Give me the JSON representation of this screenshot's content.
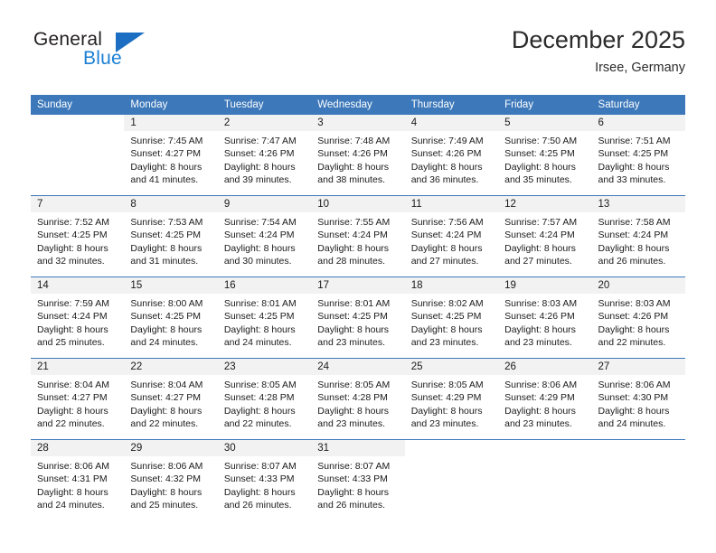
{
  "brand": {
    "name_primary": "General",
    "name_secondary": "Blue",
    "triangle_color": "#1b6ec2",
    "blue_color": "#1b7fd4"
  },
  "header": {
    "title": "December 2025",
    "location": "Irsee, Germany"
  },
  "theme": {
    "header_bg": "#3c78ba",
    "header_text": "#ffffff",
    "daynum_band_bg": "#f2f2f2",
    "row_divider": "#3c78ba",
    "text": "#1a1a1a"
  },
  "weekday_headers": [
    "Sunday",
    "Monday",
    "Tuesday",
    "Wednesday",
    "Thursday",
    "Friday",
    "Saturday"
  ],
  "labels": {
    "sunrise_prefix": "Sunrise:",
    "sunset_prefix": "Sunset:",
    "daylight_prefix": "Daylight:"
  },
  "weeks": [
    [
      {
        "day": "",
        "sunrise": "",
        "sunset": "",
        "daylight_line1": "",
        "daylight_line2": ""
      },
      {
        "day": "1",
        "sunrise": "Sunrise: 7:45 AM",
        "sunset": "Sunset: 4:27 PM",
        "daylight_line1": "Daylight: 8 hours",
        "daylight_line2": "and 41 minutes."
      },
      {
        "day": "2",
        "sunrise": "Sunrise: 7:47 AM",
        "sunset": "Sunset: 4:26 PM",
        "daylight_line1": "Daylight: 8 hours",
        "daylight_line2": "and 39 minutes."
      },
      {
        "day": "3",
        "sunrise": "Sunrise: 7:48 AM",
        "sunset": "Sunset: 4:26 PM",
        "daylight_line1": "Daylight: 8 hours",
        "daylight_line2": "and 38 minutes."
      },
      {
        "day": "4",
        "sunrise": "Sunrise: 7:49 AM",
        "sunset": "Sunset: 4:26 PM",
        "daylight_line1": "Daylight: 8 hours",
        "daylight_line2": "and 36 minutes."
      },
      {
        "day": "5",
        "sunrise": "Sunrise: 7:50 AM",
        "sunset": "Sunset: 4:25 PM",
        "daylight_line1": "Daylight: 8 hours",
        "daylight_line2": "and 35 minutes."
      },
      {
        "day": "6",
        "sunrise": "Sunrise: 7:51 AM",
        "sunset": "Sunset: 4:25 PM",
        "daylight_line1": "Daylight: 8 hours",
        "daylight_line2": "and 33 minutes."
      }
    ],
    [
      {
        "day": "7",
        "sunrise": "Sunrise: 7:52 AM",
        "sunset": "Sunset: 4:25 PM",
        "daylight_line1": "Daylight: 8 hours",
        "daylight_line2": "and 32 minutes."
      },
      {
        "day": "8",
        "sunrise": "Sunrise: 7:53 AM",
        "sunset": "Sunset: 4:25 PM",
        "daylight_line1": "Daylight: 8 hours",
        "daylight_line2": "and 31 minutes."
      },
      {
        "day": "9",
        "sunrise": "Sunrise: 7:54 AM",
        "sunset": "Sunset: 4:24 PM",
        "daylight_line1": "Daylight: 8 hours",
        "daylight_line2": "and 30 minutes."
      },
      {
        "day": "10",
        "sunrise": "Sunrise: 7:55 AM",
        "sunset": "Sunset: 4:24 PM",
        "daylight_line1": "Daylight: 8 hours",
        "daylight_line2": "and 28 minutes."
      },
      {
        "day": "11",
        "sunrise": "Sunrise: 7:56 AM",
        "sunset": "Sunset: 4:24 PM",
        "daylight_line1": "Daylight: 8 hours",
        "daylight_line2": "and 27 minutes."
      },
      {
        "day": "12",
        "sunrise": "Sunrise: 7:57 AM",
        "sunset": "Sunset: 4:24 PM",
        "daylight_line1": "Daylight: 8 hours",
        "daylight_line2": "and 27 minutes."
      },
      {
        "day": "13",
        "sunrise": "Sunrise: 7:58 AM",
        "sunset": "Sunset: 4:24 PM",
        "daylight_line1": "Daylight: 8 hours",
        "daylight_line2": "and 26 minutes."
      }
    ],
    [
      {
        "day": "14",
        "sunrise": "Sunrise: 7:59 AM",
        "sunset": "Sunset: 4:24 PM",
        "daylight_line1": "Daylight: 8 hours",
        "daylight_line2": "and 25 minutes."
      },
      {
        "day": "15",
        "sunrise": "Sunrise: 8:00 AM",
        "sunset": "Sunset: 4:25 PM",
        "daylight_line1": "Daylight: 8 hours",
        "daylight_line2": "and 24 minutes."
      },
      {
        "day": "16",
        "sunrise": "Sunrise: 8:01 AM",
        "sunset": "Sunset: 4:25 PM",
        "daylight_line1": "Daylight: 8 hours",
        "daylight_line2": "and 24 minutes."
      },
      {
        "day": "17",
        "sunrise": "Sunrise: 8:01 AM",
        "sunset": "Sunset: 4:25 PM",
        "daylight_line1": "Daylight: 8 hours",
        "daylight_line2": "and 23 minutes."
      },
      {
        "day": "18",
        "sunrise": "Sunrise: 8:02 AM",
        "sunset": "Sunset: 4:25 PM",
        "daylight_line1": "Daylight: 8 hours",
        "daylight_line2": "and 23 minutes."
      },
      {
        "day": "19",
        "sunrise": "Sunrise: 8:03 AM",
        "sunset": "Sunset: 4:26 PM",
        "daylight_line1": "Daylight: 8 hours",
        "daylight_line2": "and 23 minutes."
      },
      {
        "day": "20",
        "sunrise": "Sunrise: 8:03 AM",
        "sunset": "Sunset: 4:26 PM",
        "daylight_line1": "Daylight: 8 hours",
        "daylight_line2": "and 22 minutes."
      }
    ],
    [
      {
        "day": "21",
        "sunrise": "Sunrise: 8:04 AM",
        "sunset": "Sunset: 4:27 PM",
        "daylight_line1": "Daylight: 8 hours",
        "daylight_line2": "and 22 minutes."
      },
      {
        "day": "22",
        "sunrise": "Sunrise: 8:04 AM",
        "sunset": "Sunset: 4:27 PM",
        "daylight_line1": "Daylight: 8 hours",
        "daylight_line2": "and 22 minutes."
      },
      {
        "day": "23",
        "sunrise": "Sunrise: 8:05 AM",
        "sunset": "Sunset: 4:28 PM",
        "daylight_line1": "Daylight: 8 hours",
        "daylight_line2": "and 22 minutes."
      },
      {
        "day": "24",
        "sunrise": "Sunrise: 8:05 AM",
        "sunset": "Sunset: 4:28 PM",
        "daylight_line1": "Daylight: 8 hours",
        "daylight_line2": "and 23 minutes."
      },
      {
        "day": "25",
        "sunrise": "Sunrise: 8:05 AM",
        "sunset": "Sunset: 4:29 PM",
        "daylight_line1": "Daylight: 8 hours",
        "daylight_line2": "and 23 minutes."
      },
      {
        "day": "26",
        "sunrise": "Sunrise: 8:06 AM",
        "sunset": "Sunset: 4:29 PM",
        "daylight_line1": "Daylight: 8 hours",
        "daylight_line2": "and 23 minutes."
      },
      {
        "day": "27",
        "sunrise": "Sunrise: 8:06 AM",
        "sunset": "Sunset: 4:30 PM",
        "daylight_line1": "Daylight: 8 hours",
        "daylight_line2": "and 24 minutes."
      }
    ],
    [
      {
        "day": "28",
        "sunrise": "Sunrise: 8:06 AM",
        "sunset": "Sunset: 4:31 PM",
        "daylight_line1": "Daylight: 8 hours",
        "daylight_line2": "and 24 minutes."
      },
      {
        "day": "29",
        "sunrise": "Sunrise: 8:06 AM",
        "sunset": "Sunset: 4:32 PM",
        "daylight_line1": "Daylight: 8 hours",
        "daylight_line2": "and 25 minutes."
      },
      {
        "day": "30",
        "sunrise": "Sunrise: 8:07 AM",
        "sunset": "Sunset: 4:33 PM",
        "daylight_line1": "Daylight: 8 hours",
        "daylight_line2": "and 26 minutes."
      },
      {
        "day": "31",
        "sunrise": "Sunrise: 8:07 AM",
        "sunset": "Sunset: 4:33 PM",
        "daylight_line1": "Daylight: 8 hours",
        "daylight_line2": "and 26 minutes."
      },
      {
        "day": "",
        "sunrise": "",
        "sunset": "",
        "daylight_line1": "",
        "daylight_line2": ""
      },
      {
        "day": "",
        "sunrise": "",
        "sunset": "",
        "daylight_line1": "",
        "daylight_line2": ""
      },
      {
        "day": "",
        "sunrise": "",
        "sunset": "",
        "daylight_line1": "",
        "daylight_line2": ""
      }
    ]
  ]
}
